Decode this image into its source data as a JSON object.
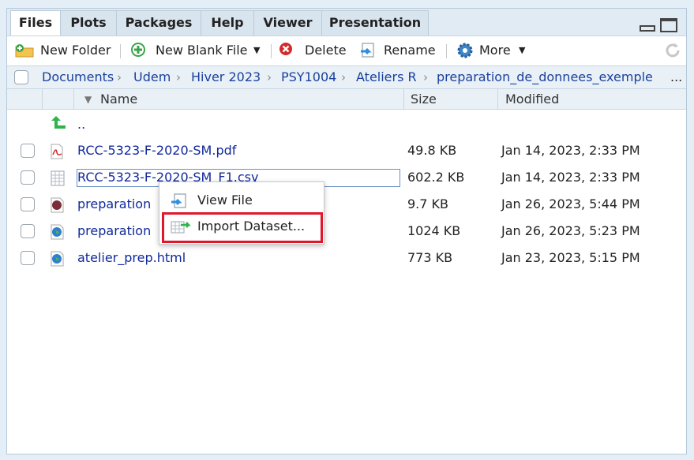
{
  "tabs": [
    {
      "label": "Files",
      "active": true
    },
    {
      "label": "Plots",
      "active": false
    },
    {
      "label": "Packages",
      "active": false
    },
    {
      "label": "Help",
      "active": false
    },
    {
      "label": "Viewer",
      "active": false
    },
    {
      "label": "Presentation",
      "active": false
    }
  ],
  "toolbar": {
    "new_folder": "New Folder",
    "new_blank_file": "New Blank File",
    "delete": "Delete",
    "rename": "Rename",
    "more": "More"
  },
  "breadcrumb": [
    "Documents",
    "Udem",
    "Hiver 2023",
    "PSY1004",
    "Ateliers R",
    "preparation_de_donnees_exemple"
  ],
  "breadcrumb_more": "...",
  "columns": {
    "name": "Name",
    "size": "Size",
    "modified": "Modified"
  },
  "parent_dir": "..",
  "files": [
    {
      "name": "RCC-5323-F-2020-SM.pdf",
      "size": "49.8 KB",
      "modified": "Jan 14, 2023, 2:33 PM",
      "icon": "pdf-icon"
    },
    {
      "name": "RCC-5323-F-2020-SM_F1.csv",
      "size": "602.2 KB",
      "modified": "Jan 14, 2023, 2:33 PM",
      "icon": "csv-icon"
    },
    {
      "name": "preparation",
      "size": "9.7 KB",
      "modified": "Jan 26, 2023, 5:44 PM",
      "icon": "rmd-icon"
    },
    {
      "name": "preparation",
      "size": "1024 KB",
      "modified": "Jan 26, 2023, 5:23 PM",
      "icon": "html-globe-icon"
    },
    {
      "name": "atelier_prep.html",
      "size": "773 KB",
      "modified": "Jan 23, 2023, 5:15 PM",
      "icon": "html-globe-icon"
    }
  ],
  "context_menu": {
    "view_file": "View File",
    "import_dataset": "Import Dataset..."
  },
  "colors": {
    "link": "#10289b",
    "highlight": "#e0162b",
    "accent": "#e3eef6"
  }
}
